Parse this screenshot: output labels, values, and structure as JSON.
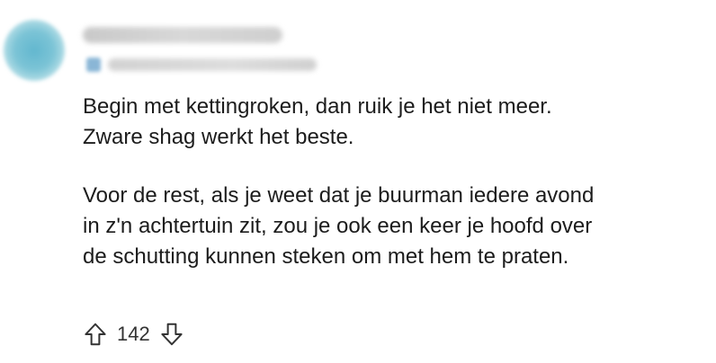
{
  "comment": {
    "author": "",
    "flair": "",
    "paragraphs": [
      {
        "lines": [
          "Begin met kettingroken, dan ruik je het niet meer.",
          "Zware shag werkt het beste."
        ]
      },
      {
        "lines": [
          "Voor de rest, als je weet dat je buurman iedere avond",
          "in z'n achtertuin zit, zou je ook een keer je hoofd over",
          "de schutting kunnen steken om met hem te praten."
        ]
      }
    ],
    "score": "142"
  },
  "icons": {
    "avatar": "avatar",
    "flair": "flair-icon",
    "upvote": "arrow-up-icon",
    "downvote": "arrow-down-icon"
  },
  "colors": {
    "text": "#1c1c1c",
    "avatar": "#62b7cf",
    "icon_stroke": "#333333"
  }
}
